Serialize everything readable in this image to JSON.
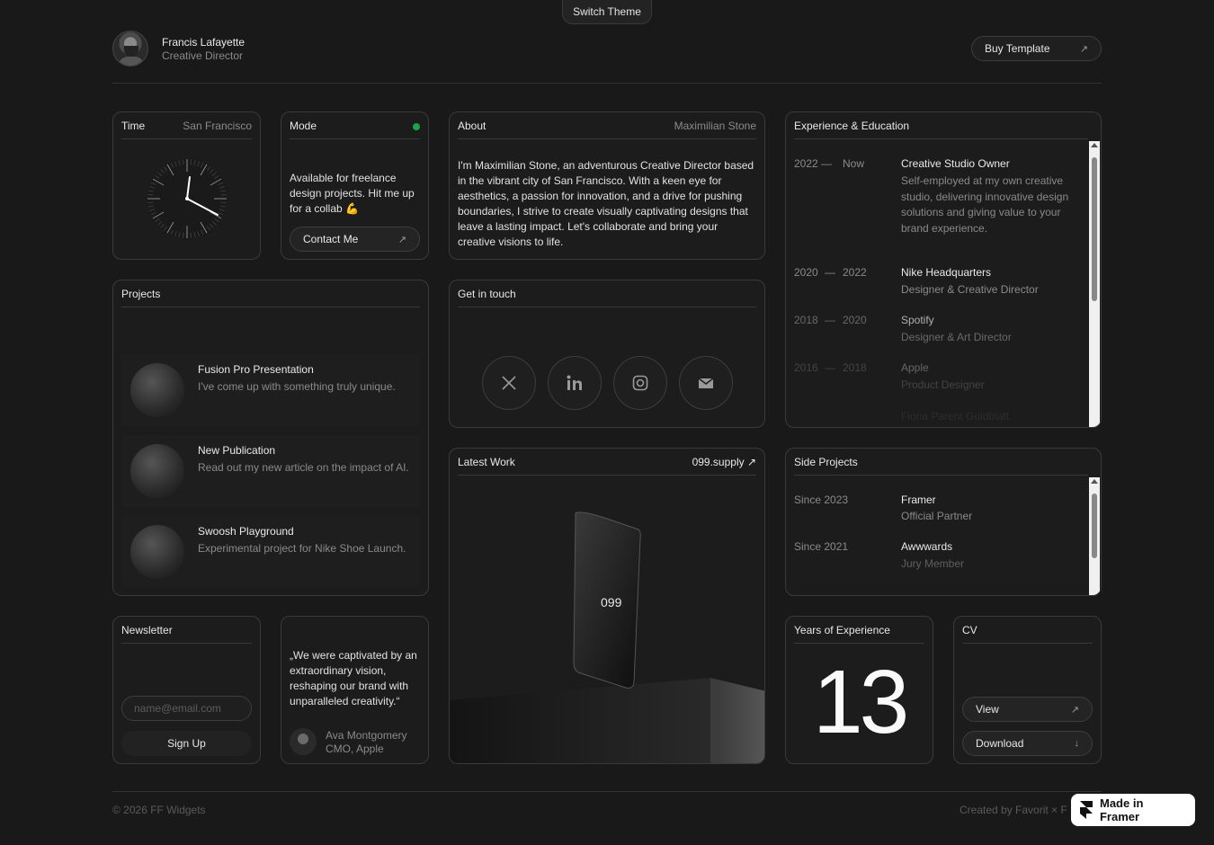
{
  "topbar": {
    "switch_theme": "Switch Theme"
  },
  "profile": {
    "name": "Francis Lafayette",
    "role": "Creative Director",
    "buy_label": "Buy Template"
  },
  "time": {
    "title": "Time",
    "location": "San Francisco"
  },
  "mode": {
    "title": "Mode",
    "text": "Available for freelance design projects. Hit me up for a collab 💪",
    "contact_label": "Contact Me",
    "status_color": "#19a34a"
  },
  "about": {
    "title": "About",
    "author": "Maximilian Stone",
    "text": "I'm Maximilian Stone, an adventurous Creative Director based in the vibrant city of San Francisco. With a keen eye for aesthetics, a passion for innovation, and a drive for pushing boundaries, I strive to create visually captivating designs that leave a lasting impact. Let's collaborate and bring your creative visions to life."
  },
  "experience": {
    "title": "Experience & Education",
    "items": [
      {
        "start": "2022",
        "end": "Now",
        "title": "Creative Studio Owner",
        "desc": "Self-employed at my own creative studio, delivering innovative design solutions and giving value to your brand experience."
      },
      {
        "start": "2020",
        "end": "2022",
        "title": "Nike Headquarters",
        "desc": "Designer & Creative Director"
      },
      {
        "start": "2018",
        "end": "2020",
        "title": "Spotify",
        "desc": "Designer & Art Director"
      },
      {
        "start": "2016",
        "end": "2018",
        "title": "Apple",
        "desc": "Product Designer"
      },
      {
        "start": "",
        "end": "",
        "title": "Fiona Parent Goldblatt",
        "desc": ""
      }
    ]
  },
  "projects": {
    "title": "Projects",
    "items": [
      {
        "title": "Fusion Pro Presentation",
        "desc": "I've come up with something truly unique."
      },
      {
        "title": "New Publication",
        "desc": "Read out my new article on the impact of AI."
      },
      {
        "title": "Swoosh Playground",
        "desc": "Experimental project for Nike Shoe Launch."
      }
    ]
  },
  "contact": {
    "title": "Get in touch"
  },
  "latest": {
    "title": "Latest Work",
    "link": "099.supply ↗",
    "phone_label": "099"
  },
  "side": {
    "title": "Side Projects",
    "items": [
      {
        "since": "Since 2023",
        "title": "Framer",
        "desc": "Official Partner"
      },
      {
        "since": "Since 2021",
        "title": "Awwwards",
        "desc": "Jury Member"
      }
    ]
  },
  "newsletter": {
    "title": "Newsletter",
    "placeholder": "name@email.com",
    "signup_label": "Sign Up"
  },
  "quote": {
    "text": "„We were captivated by an extraordinary vision, reshaping our brand with unparalleled creativity.“",
    "author": "Ava Montgomery",
    "author_role": "CMO, Apple"
  },
  "years": {
    "title": "Years of Experience",
    "value": "13"
  },
  "cv": {
    "title": "CV",
    "view_label": "View",
    "download_label": "Download"
  },
  "footer": {
    "copyright": "© 2026 FF Widgets",
    "credit": "Created by Favorit × F",
    "framer_badge": "Made in Framer"
  }
}
